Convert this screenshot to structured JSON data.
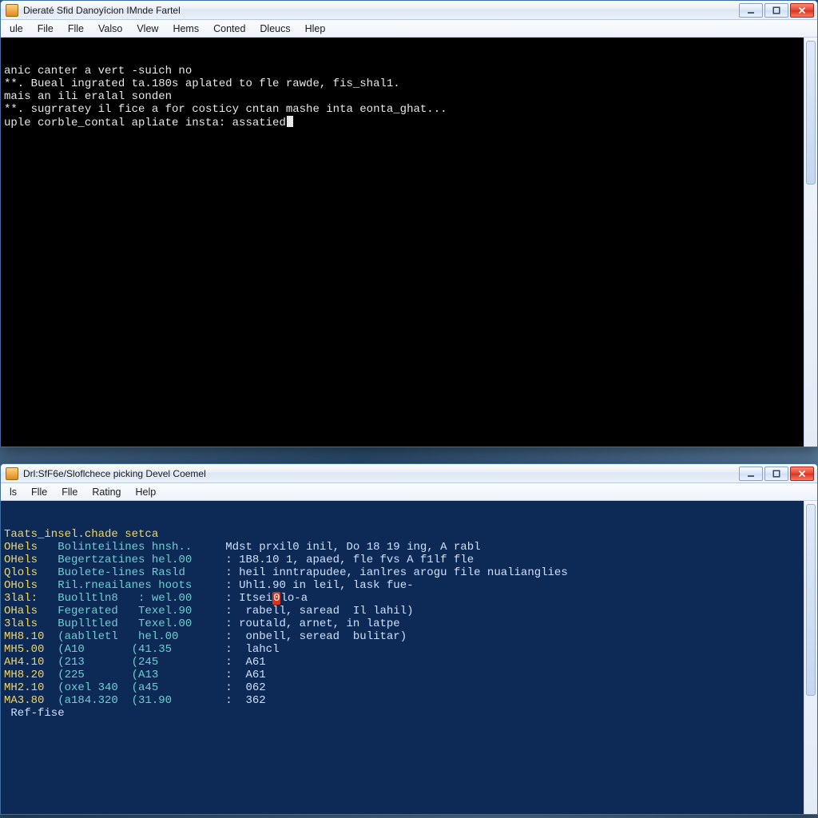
{
  "window1": {
    "title": "Dieraté Sfid Danoyîcion IMnde Fartel",
    "menus": [
      "ule",
      "File",
      "Flle",
      "Valso",
      "Vlew",
      "Hems",
      "Conted",
      "Dleucs",
      "Hlep"
    ],
    "lines": [
      {
        "cls": "",
        "text": "anic canter a vert -suich no"
      },
      {
        "cls": "",
        "text": "**. Bueal ingrated ta.180s aplated to fle rawde, fis_shal1."
      },
      {
        "cls": "",
        "text": ""
      },
      {
        "cls": "",
        "text": "mais an ili eralal sonden"
      },
      {
        "cls": "",
        "text": "**. sugrratey il fice a for costicy cntan mashe inta eonta_ghat..."
      },
      {
        "cls": "",
        "text": ""
      },
      {
        "cls": "",
        "text": "uple corble_contal apliate insta: assatied",
        "cursor": true
      }
    ]
  },
  "window2": {
    "title": "Drl:SfF6e/Sloflchece picking Devel Coemel",
    "menus": [
      "ls",
      "Flle",
      "Flle",
      "Rating",
      "Help"
    ],
    "header_line": "Taats_insel.chade setca",
    "rows": [
      {
        "c0": "OHels",
        "c1": "Bolinteilines hnsh..",
        "c2": "Mdst prxil0 inil, Do 18 19 ing, A rabl"
      },
      {
        "c0": "OHels",
        "c1": "Begertzatines hel.00",
        "c2": ": 1B8.10 1, apaed, fle fvs A f1lf fle"
      },
      {
        "c0": "Qlols",
        "c1": "Buolete-lines Rasld",
        "c2": ": heil inntrapudee, ianlres arogu file nualianglies"
      },
      {
        "c0": "OHols",
        "c1": "Ril.rneailanes hoots",
        "c2": ": Uhl1.90 in leil, lask fue-"
      },
      {
        "c0": "3lal:",
        "c1": "Buolltln8   : wel.00",
        "c2": ": Itsei0lo-a",
        "hot": true
      },
      {
        "c0": "OHals",
        "c1": "Fegerated   Texel.90",
        "c2": ":  rabell, saread  Il lahil)"
      },
      {
        "c0": "3lals",
        "c1": "Buplltled   Texel.00",
        "c2": ": routald, arnet, in latpe"
      },
      {
        "c0": "MH8.10",
        "c1": "(aablletl   hel.00",
        "c2": ":  onbell, seread  bulitar)"
      },
      {
        "c0": "MH5.00",
        "c1": "(A10       (41.35",
        "c2": ":  lahcl"
      },
      {
        "c0": "AH4.10",
        "c1": "(213       (245",
        "c2": ":  A61"
      },
      {
        "c0": "MH8.20",
        "c1": "(225       (A13",
        "c2": ":  A61"
      },
      {
        "c0": "MH2.10",
        "c1": "(oxel 340  (a45",
        "c2": ":  062"
      },
      {
        "c0": "MA3.80",
        "c1": "(a184.320  (31.90",
        "c2": ":  362"
      }
    ],
    "footer_line": " Ref-fise"
  },
  "winbuttons": {
    "min": "minimize",
    "max": "maximize",
    "close": "close"
  }
}
